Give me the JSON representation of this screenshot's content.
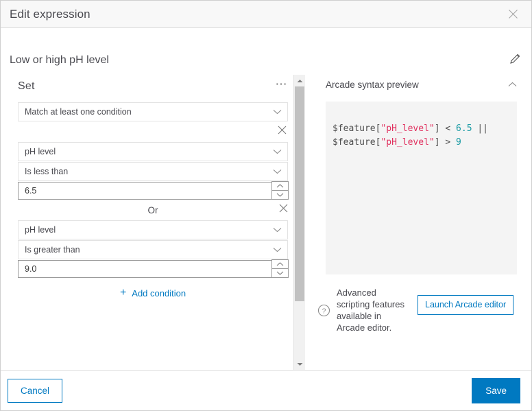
{
  "header": {
    "title": "Edit expression",
    "close_icon": "close-icon"
  },
  "expression": {
    "name": "Low or high pH level",
    "edit_icon": "pencil-icon"
  },
  "set": {
    "label": "Set",
    "menu_icon": "ellipsis-icon",
    "match_mode": "Match at least one condition",
    "remove_set_icon": "close-icon",
    "conditions": [
      {
        "field": "pH level",
        "operator": "Is less than",
        "value": "6.5"
      },
      {
        "field": "pH level",
        "operator": "Is greater than",
        "value": "9.0"
      }
    ],
    "joiner": "Or",
    "remove_condition_icon": "close-icon",
    "add_condition": "Add condition",
    "add_condition_icon": "plus-icon"
  },
  "preview": {
    "title": "Arcade syntax preview",
    "collapse_icon": "chevron-up-icon",
    "code_lines": [
      [
        {
          "t": "$feature[",
          "c": "tok-op"
        },
        {
          "t": "\"pH_level\"",
          "c": "tok-str"
        },
        {
          "t": "] < ",
          "c": "tok-op"
        },
        {
          "t": "6.5",
          "c": "tok-num"
        },
        {
          "t": " ||",
          "c": "tok-op"
        }
      ],
      [
        {
          "t": "$feature[",
          "c": "tok-op"
        },
        {
          "t": "\"pH_level\"",
          "c": "tok-str"
        },
        {
          "t": "] > ",
          "c": "tok-op"
        },
        {
          "t": "9",
          "c": "tok-num"
        }
      ]
    ]
  },
  "advanced": {
    "help_icon": "help-circle-icon",
    "text": "Advanced scripting features available in Arcade editor.",
    "launch_label": "Launch Arcade editor"
  },
  "footer": {
    "cancel": "Cancel",
    "save": "Save"
  },
  "colors": {
    "accent": "#0079c1",
    "string": "#e0305e",
    "number": "#1a9ba4",
    "code": "#4e4e4e"
  }
}
